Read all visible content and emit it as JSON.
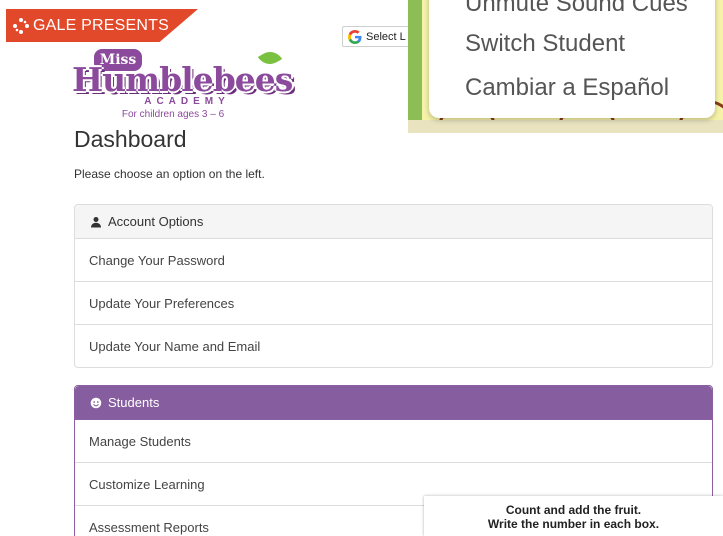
{
  "banner": {
    "label": "GALE PRESENTS",
    "icon": "gale-star-icon",
    "color": "#e2492a"
  },
  "translate": {
    "label": "Select L",
    "icon": "google-g-icon"
  },
  "logo": {
    "miss": "Miss",
    "name": "Humblebees",
    "academy": "ACADEMY",
    "tagline": "For children ages 3 – 6"
  },
  "page": {
    "title": "Dashboard",
    "subtitle": "Please choose an option on the left."
  },
  "account": {
    "header": "Account Options",
    "icon": "user-icon",
    "items": [
      "Change Your Password",
      "Update Your Preferences",
      "Update Your Name and Email"
    ]
  },
  "students": {
    "header": "Students",
    "icon": "smiley-icon",
    "accent": "#865e9f",
    "items": [
      "Manage Students",
      "Customize Learning",
      "Assessment Reports"
    ]
  },
  "menu": {
    "items": [
      "Unmute Sound Cues",
      "Switch Student",
      "Cambiar a Español"
    ]
  },
  "worksheet": {
    "line1": "Count and add the fruit.",
    "line2": "Write the number in each box."
  }
}
